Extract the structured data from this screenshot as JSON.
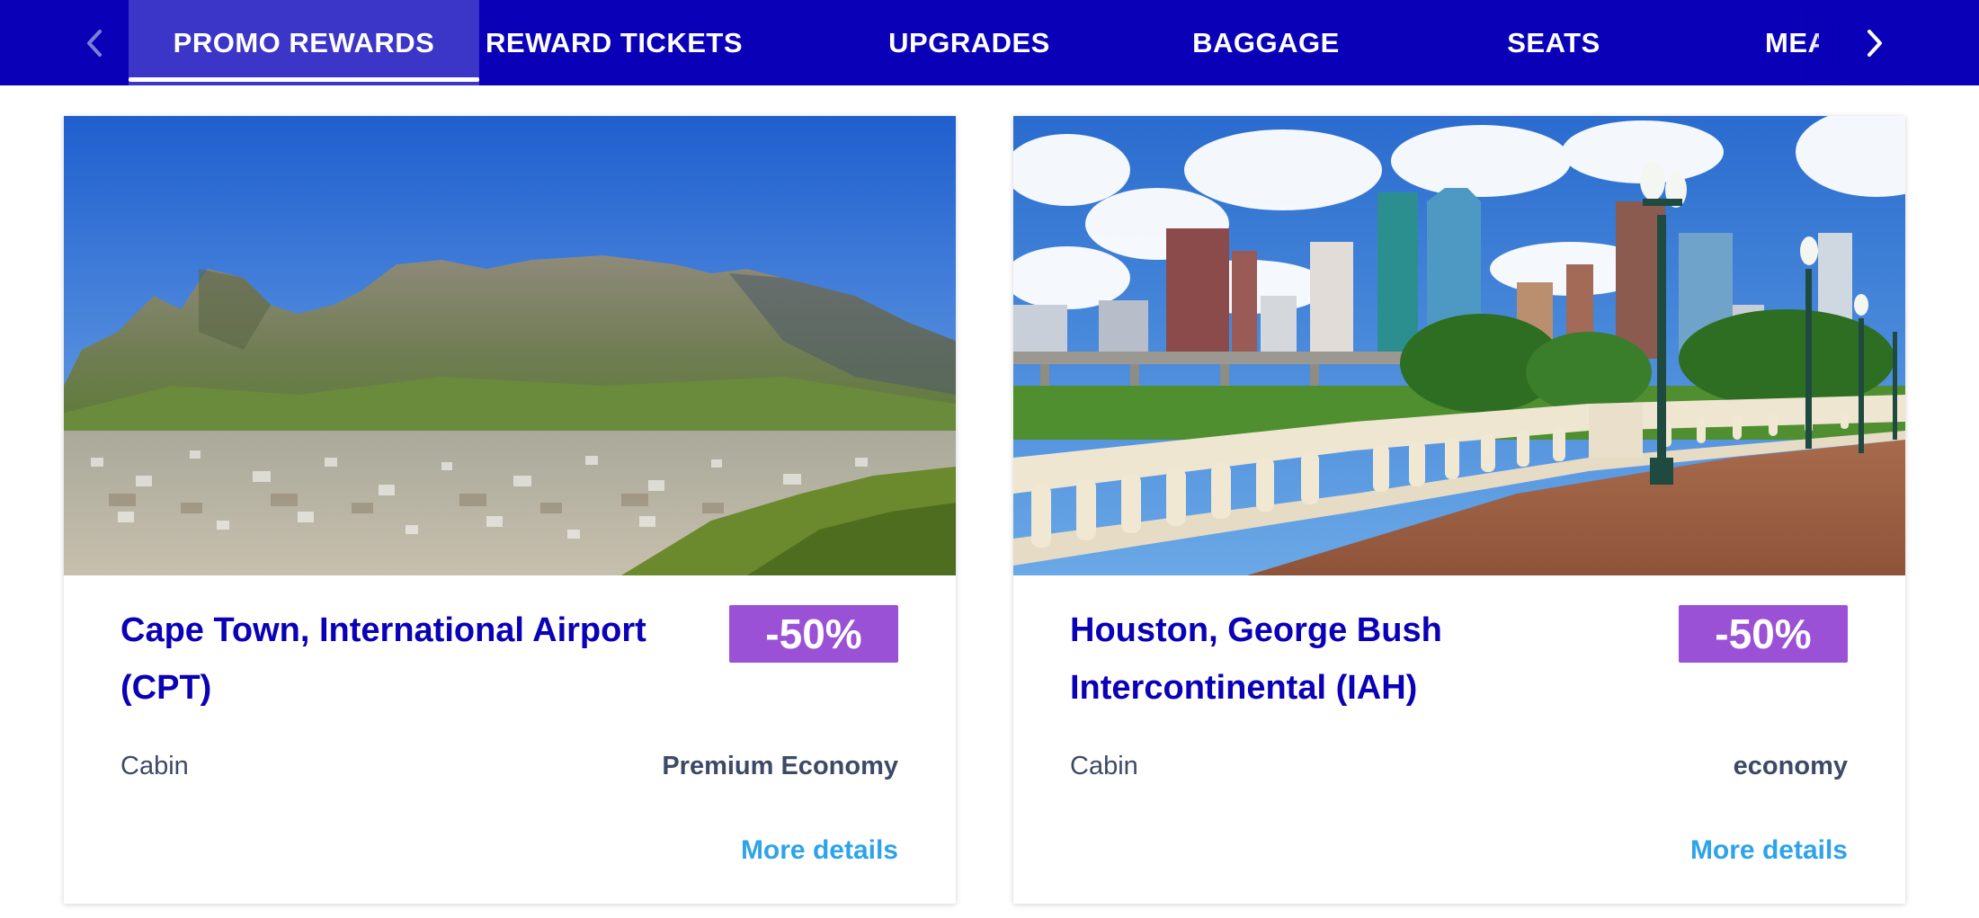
{
  "tabs": [
    {
      "label": "PROMO REWARDS",
      "active": true
    },
    {
      "label": "REWARD TICKETS",
      "active": false
    },
    {
      "label": "UPGRADES",
      "active": false
    },
    {
      "label": "BAGGAGE",
      "active": false
    },
    {
      "label": "SEATS",
      "active": false
    },
    {
      "label": "MEA",
      "active": false
    }
  ],
  "nav": {
    "prev_icon": "chevron-left-icon",
    "next_icon": "chevron-right-icon"
  },
  "colors": {
    "nav_background": "#0a00b7",
    "active_tab_background": "#3b35c8",
    "title_text": "#0a00b7",
    "badge_background": "#9b51d6",
    "link": "#2ea3ea",
    "body_text": "#3c4a66"
  },
  "cards": [
    {
      "title": "Cape Town, International Airport (CPT)",
      "discount": "-50%",
      "cabin_label": "Cabin",
      "cabin_value": "Premium Economy",
      "link_label": "More details",
      "image": "cape-town-table-mountain-photo"
    },
    {
      "title": "Houston, George Bush Intercontinental (IAH)",
      "discount": "-50%",
      "cabin_label": "Cabin",
      "cabin_value": "economy",
      "link_label": "More details",
      "image": "houston-skyline-bridge-photo"
    }
  ]
}
